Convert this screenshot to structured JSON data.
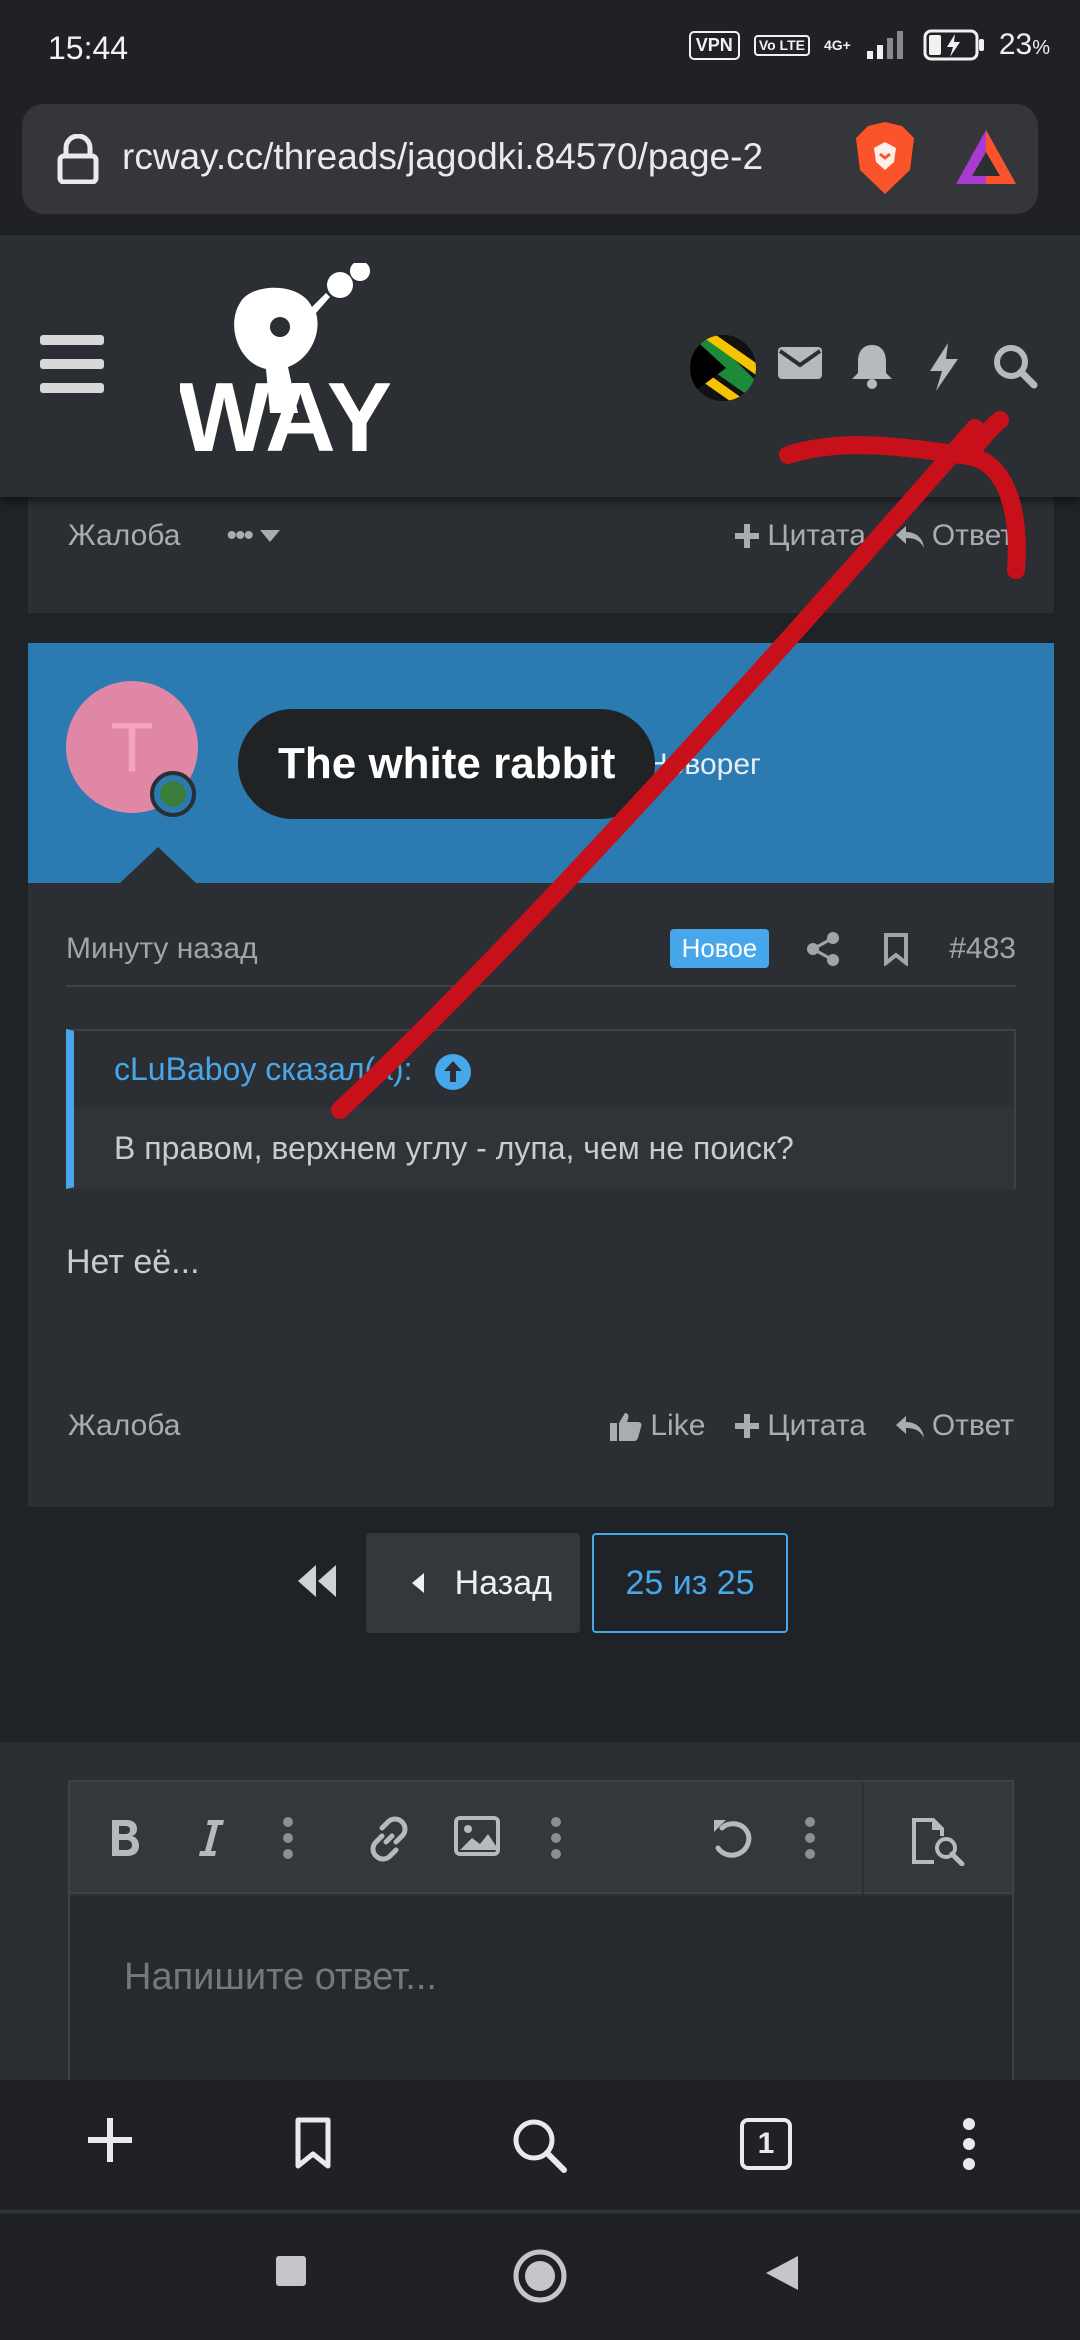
{
  "status_bar": {
    "time": "15:44",
    "vpn": "VPN",
    "volte": "Vo LTE",
    "network": "4G+",
    "battery_pct": "23",
    "battery_unit": "%"
  },
  "browser": {
    "url": "rcway.cc/threads/jagodki.84570/page-2",
    "tab_count": "1"
  },
  "forum_header": {
    "logo_text": "WAY"
  },
  "prev_post_actions": {
    "report": "Жалоба",
    "more": "•••",
    "quote": "Цитата",
    "reply": "Ответ"
  },
  "post": {
    "avatar_letter": "T",
    "username": "The white rabbit",
    "user_title": "Новорег",
    "time": "Минуту назад",
    "badge_new": "Новое",
    "post_number": "#483",
    "quote_author": "cLuBaboy сказал(а):",
    "quote_text": "В правом, верхнем углу - лупа, чем не поиск?",
    "body": "Нет её...",
    "actions": {
      "report": "Жалоба",
      "like": "Like",
      "quote": "Цитата",
      "reply": "Ответ"
    }
  },
  "pagination": {
    "prev": "Назад",
    "current": "25 из 25"
  },
  "editor": {
    "placeholder": "Напишите ответ..."
  },
  "colors": {
    "accent": "#47a7eb",
    "user_band": "#2b7ab1",
    "annotation": "#c8101a"
  }
}
